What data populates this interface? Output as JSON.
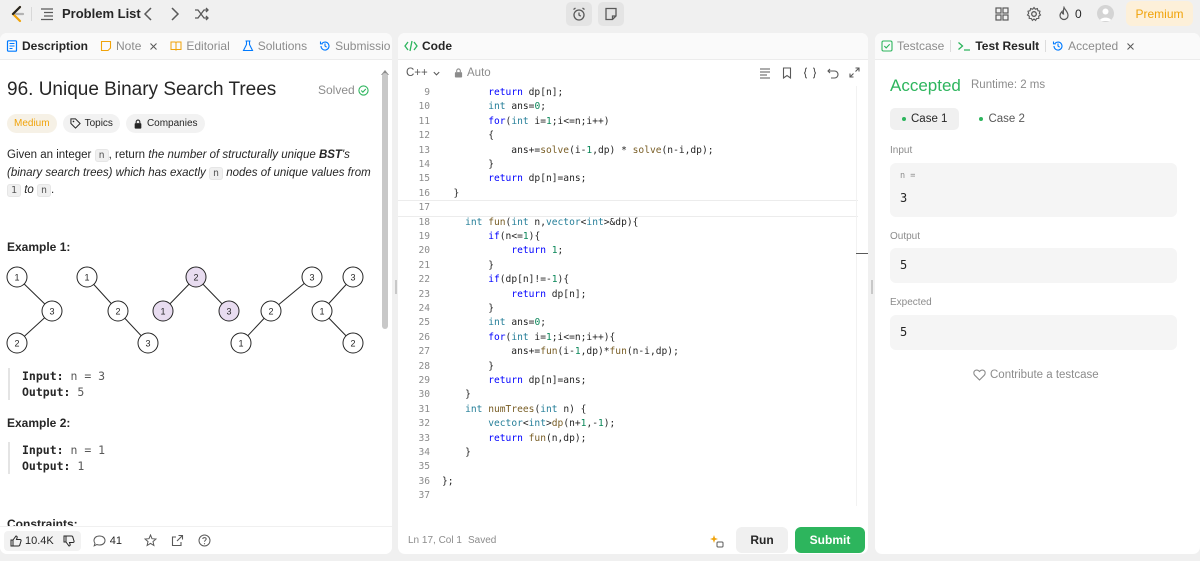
{
  "topbar": {
    "title": "Problem List",
    "streak": "0",
    "premium": "Premium"
  },
  "description_tabs": [
    {
      "label": "Description"
    },
    {
      "label": "Note"
    },
    {
      "label": "Editorial"
    },
    {
      "label": "Solutions"
    },
    {
      "label": "Submissio"
    }
  ],
  "problem": {
    "title": "96. Unique Binary Search Trees",
    "status": "Solved",
    "difficulty": "Medium",
    "topics": "Topics",
    "companies": "Companies",
    "desc_1": "Given an integer ",
    "desc_n": "n",
    "desc_2": ", return ",
    "desc_em1": "the number of structurally unique ",
    "desc_bst": "BST",
    "desc_em2": "'s (binary search trees) which has exactly ",
    "desc_n2": "n",
    "desc_em3": " nodes of unique values from ",
    "desc_1val": "1",
    "desc_to": " to ",
    "desc_nval": "n",
    "desc_end": ".",
    "example1_title": "Example 1:",
    "example1_input_label": "Input:",
    "example1_input": "n = 3",
    "example1_output_label": "Output:",
    "example1_output": "5",
    "example2_title": "Example 2:",
    "example2_input_label": "Input:",
    "example2_input": "n = 1",
    "example2_output_label": "Output:",
    "example2_output": "1",
    "constraints": "Constraints:",
    "trees": [
      [
        "1",
        "3",
        "2"
      ],
      [
        "1",
        "2",
        "3"
      ],
      [
        "2",
        "1",
        "3"
      ],
      [
        "3",
        "2",
        "1"
      ],
      [
        "3",
        "1",
        "2"
      ]
    ]
  },
  "left_footer": {
    "likes": "10.4K",
    "comments": "41"
  },
  "code": {
    "tab": "Code",
    "language": "C++",
    "mode": "Auto",
    "cursor": "Ln 17, Col 1",
    "saved": "Saved",
    "run": "Run",
    "submit": "Submit",
    "lines": [
      {
        "n": "9",
        "html": "        <span class=\"kw\">return</span> dp[n];"
      },
      {
        "n": "10",
        "html": "        <span class=\"ty\">int</span> ans=<span class=\"num\">0</span>;"
      },
      {
        "n": "11",
        "html": "        <span class=\"kw\">for</span>(<span class=\"ty\">int</span> i=<span class=\"num\">1</span>;i&lt;=n;i++)"
      },
      {
        "n": "12",
        "html": "        {"
      },
      {
        "n": "13",
        "html": "            ans+=<span class=\"fn\">solve</span>(i-<span class=\"num\">1</span>,dp) * <span class=\"fn\">solve</span>(n-i,dp);"
      },
      {
        "n": "14",
        "html": "        }"
      },
      {
        "n": "15",
        "html": "        <span class=\"kw\">return</span> dp[n]=ans;"
      },
      {
        "n": "16",
        "html": "  }"
      },
      {
        "n": "17",
        "html": ""
      },
      {
        "n": "18",
        "html": "    <span class=\"ty\">int</span> <span class=\"fn\">fun</span>(<span class=\"ty\">int</span> n,<span class=\"ty\">vector</span>&lt;<span class=\"ty\">int</span>&gt;&amp;dp){"
      },
      {
        "n": "19",
        "html": "        <span class=\"kw\">if</span>(n&lt;=<span class=\"num\">1</span>){"
      },
      {
        "n": "20",
        "html": "            <span class=\"kw\">return</span> <span class=\"num\">1</span>;"
      },
      {
        "n": "21",
        "html": "        }"
      },
      {
        "n": "22",
        "html": "        <span class=\"kw\">if</span>(dp[n]!=-<span class=\"num\">1</span>){"
      },
      {
        "n": "23",
        "html": "            <span class=\"kw\">return</span> dp[n];"
      },
      {
        "n": "24",
        "html": "        }"
      },
      {
        "n": "25",
        "html": "        <span class=\"ty\">int</span> ans=<span class=\"num\">0</span>;"
      },
      {
        "n": "26",
        "html": "        <span class=\"kw\">for</span>(<span class=\"ty\">int</span> i=<span class=\"num\">1</span>;i&lt;=n;i++){"
      },
      {
        "n": "27",
        "html": "            ans+=<span class=\"fn\">fun</span>(i-<span class=\"num\">1</span>,dp)*<span class=\"fn\">fun</span>(n-i,dp);"
      },
      {
        "n": "28",
        "html": "        }"
      },
      {
        "n": "29",
        "html": "        <span class=\"kw\">return</span> dp[n]=ans;"
      },
      {
        "n": "30",
        "html": "    }"
      },
      {
        "n": "31",
        "html": "    <span class=\"ty\">int</span> <span class=\"fn\">numTrees</span>(<span class=\"ty\">int</span> n) {"
      },
      {
        "n": "32",
        "html": "        <span class=\"ty\">vector</span>&lt;<span class=\"ty\">int</span>&gt;<span class=\"fn\">dp</span>(n+<span class=\"num\">1</span>,-<span class=\"num\">1</span>);"
      },
      {
        "n": "33",
        "html": "        <span class=\"kw\">return</span> <span class=\"fn\">fun</span>(n,dp);"
      },
      {
        "n": "34",
        "html": "    }"
      },
      {
        "n": "35",
        "html": ""
      },
      {
        "n": "36",
        "html": "};"
      },
      {
        "n": "37",
        "html": ""
      }
    ]
  },
  "result_tabs": [
    {
      "label": "Testcase"
    },
    {
      "label": "Test Result"
    },
    {
      "label": "Accepted"
    }
  ],
  "result": {
    "status": "Accepted",
    "runtime": "Runtime: 2 ms",
    "case1": "Case 1",
    "case2": "Case 2",
    "input_label": "Input",
    "input_var": "n =",
    "input_value": "3",
    "output_label": "Output",
    "output_value": "5",
    "expected_label": "Expected",
    "expected_value": "5",
    "contribute": "Contribute a testcase"
  },
  "colors": {
    "accent_green": "#2db55d",
    "medium": "#f0a30a",
    "premium": "#f0a30a",
    "tree_highlight": "#e8dcf0"
  }
}
